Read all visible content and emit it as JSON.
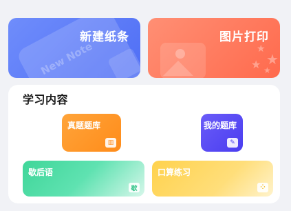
{
  "cards": {
    "new_note": {
      "title": "新建纸条",
      "deco_text": "New Note"
    },
    "photo_print": {
      "title": "图片打印"
    }
  },
  "section": {
    "title": "学习内容",
    "tiles": [
      {
        "label": "真题题库",
        "icon": "book-icon",
        "icon_glyph": "▥"
      },
      {
        "label": "我的题库",
        "icon": "edit-icon",
        "icon_glyph": "✎"
      },
      {
        "label": "歇后语",
        "icon": "xie-icon",
        "icon_glyph": "歇"
      },
      {
        "label": "口算练习",
        "icon": "dice-icon",
        "icon_glyph": "⁘"
      }
    ]
  },
  "colors": {
    "new_note": "#5b7af7",
    "photo_print": "#ff7a5c",
    "question_bank": "#ff961f",
    "my_bank": "#4f42f2",
    "xiehouyu": "#42d79c",
    "kousuan": "#ffd34f"
  }
}
